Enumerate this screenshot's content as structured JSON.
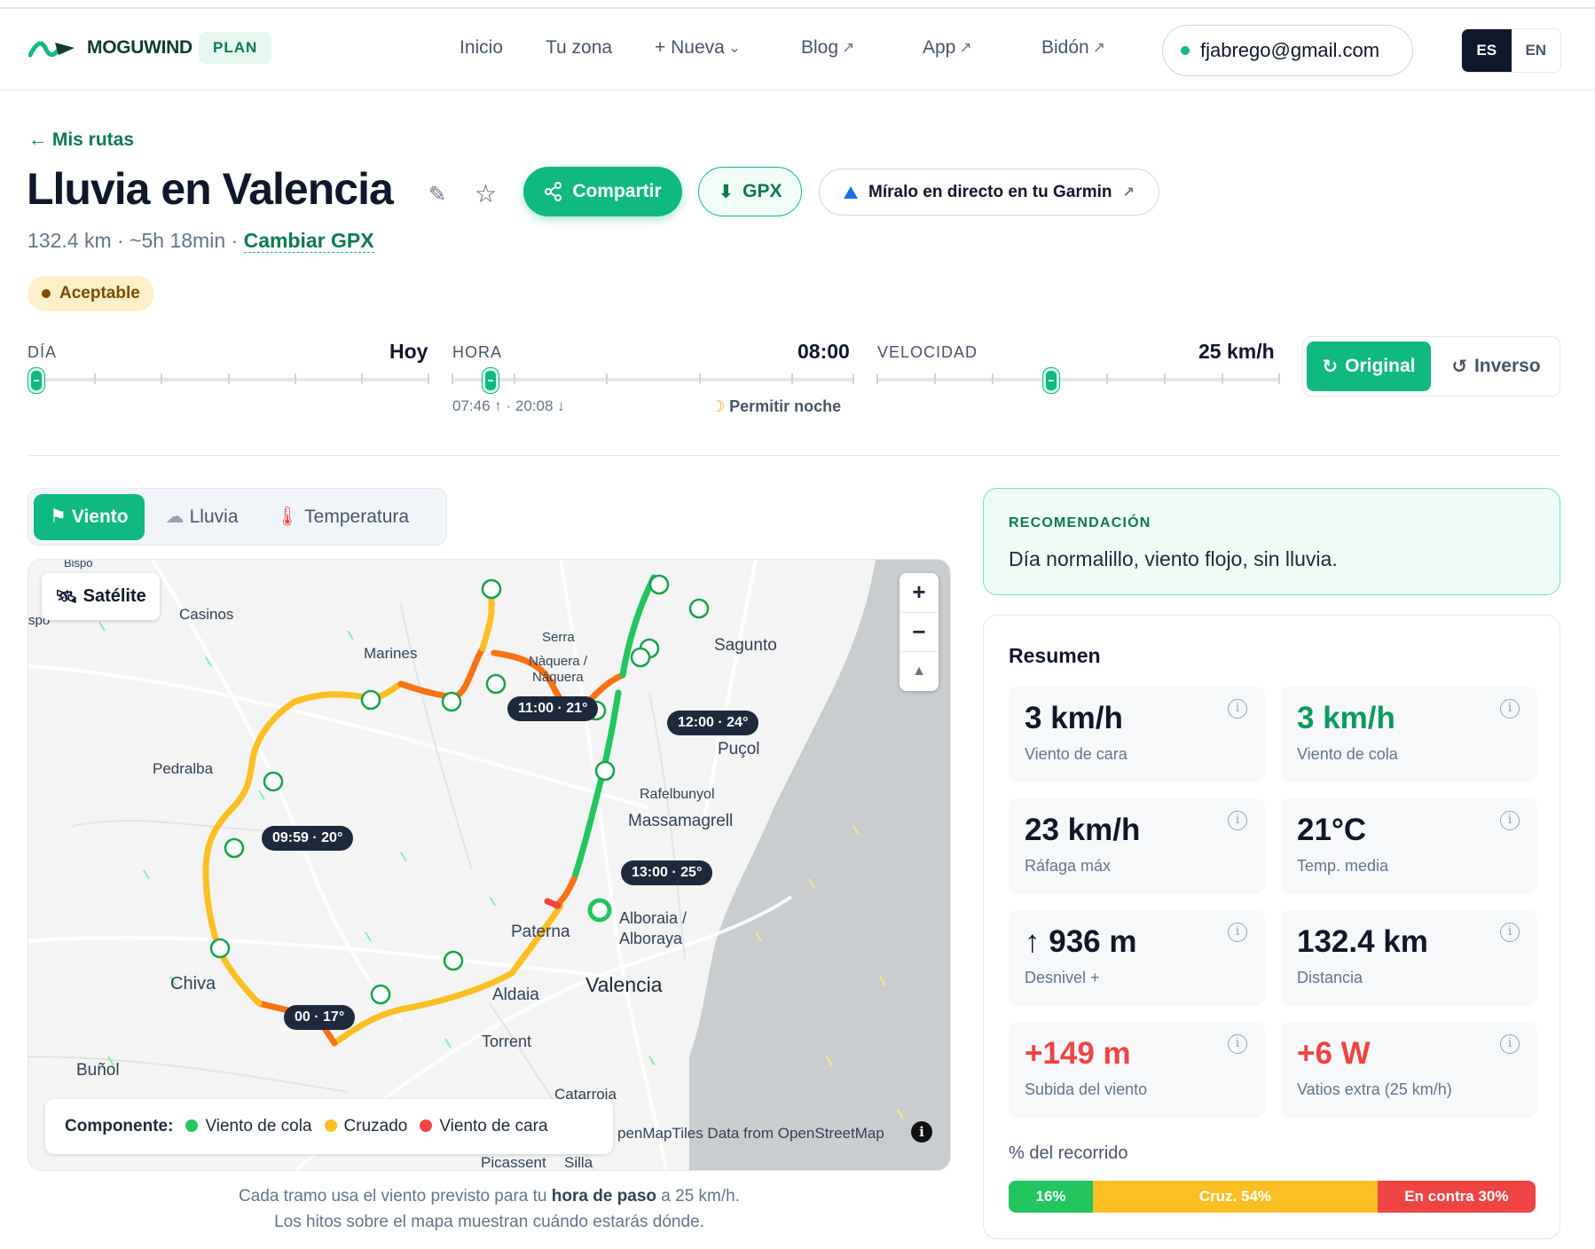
{
  "header": {
    "brand": "MOGUWIND",
    "plan": "PLAN",
    "nav": [
      {
        "label": "Inicio",
        "arrow": ""
      },
      {
        "label": "Tu zona",
        "arrow": ""
      },
      {
        "label": "+ Nueva",
        "arrow": "⌄"
      },
      {
        "label": "Blog",
        "arrow": "↗"
      },
      {
        "label": "App",
        "arrow": "↗"
      },
      {
        "label": "Bidón",
        "arrow": "↗"
      }
    ],
    "email": "fjabrego@gmail.com",
    "lang": {
      "es": "ES",
      "en": "EN"
    }
  },
  "route": {
    "back": "← Mis rutas",
    "title": "Lluvia en Valencia",
    "share": "Compartir",
    "gpx": "GPX",
    "garmin": "Míralo en directo en tu Garmin",
    "distance": "132.4 km",
    "duration": "~5h 18min",
    "change_gpx": "Cambiar GPX",
    "rating": "Aceptable",
    "rating_color": "#7c4a03"
  },
  "sliders": {
    "day": {
      "label": "DÍA",
      "value": "Hoy"
    },
    "hour": {
      "label": "HORA",
      "value": "08:00",
      "sunrise": "07:46 ↑ · 20:08 ↓",
      "night": "Permitir noche"
    },
    "speed": {
      "label": "VELOCIDAD",
      "value": "25 km/h"
    },
    "direction": {
      "original": "Original",
      "inverse": "Inverso"
    }
  },
  "layers": {
    "wind": "Viento",
    "rain": "Lluvia",
    "temp": "Temperatura"
  },
  "map": {
    "satellite": "Satélite",
    "towns": [
      "Casinos",
      "Marines",
      "Serra",
      "Nàquera /",
      "Náquera",
      "Sagunto",
      "Pedralba",
      "Rafelbunyol",
      "Massamagrell",
      "Alboraia /",
      "Alboraya",
      "Paterna",
      "Chiva",
      "Aldaia",
      "Valencia",
      "Torrent",
      "Buñol",
      "Catarroja",
      "Picassent",
      "Silla",
      "spo",
      "Bispo",
      "Puçol"
    ],
    "waypoints": [
      "11:00 · 21°",
      "12:00 · 24°",
      "09:59 · 20°",
      "13:00 · 25°",
      "00 · 17°"
    ],
    "legend": {
      "title": "Componente:",
      "tail": "Viento de cola",
      "cross": "Cruzado",
      "head": "Viento de cara"
    },
    "attribution": "penMapTiles Data from OpenStreetMap",
    "colors": {
      "tail": "#22c55e",
      "cross": "#fbbf24",
      "head": "#ef4444",
      "mixed": "#f97316"
    }
  },
  "caption": {
    "line1_a": "Cada tramo usa el viento previsto para tu ",
    "line1_b": "hora de paso",
    "line1_c": " a 25 km/h.",
    "line2": "Los hitos sobre el mapa muestran cuándo estarás dónde."
  },
  "recommendation": {
    "label": "RECOMENDACIÓN",
    "text": "Día normalillo, viento flojo, sin lluvia."
  },
  "summary": {
    "title": "Resumen",
    "cards": [
      {
        "value": "3 km/h",
        "label": "Viento de cara",
        "tone": ""
      },
      {
        "value": "3 km/h",
        "label": "Viento de cola",
        "tone": "green"
      },
      {
        "value": "23 km/h",
        "label": "Ráfaga máx",
        "tone": ""
      },
      {
        "value": "21°C",
        "label": "Temp. media",
        "tone": ""
      },
      {
        "value": "↑ 936 m",
        "label": "Desnivel +",
        "tone": ""
      },
      {
        "value": "132.4 km",
        "label": "Distancia",
        "tone": ""
      },
      {
        "value": "+149 m",
        "label": "Subida del viento",
        "tone": "red"
      },
      {
        "value": "+6 W",
        "label": "Vatios extra (25 km/h)",
        "tone": "red"
      }
    ],
    "pct_label": "% del recorrido",
    "pct": [
      {
        "label": "16%",
        "value": 16,
        "color": "#22c55e"
      },
      {
        "label": "Cruz. 54%",
        "value": 54,
        "color": "#fbbf24"
      },
      {
        "label": "En contra 30%",
        "value": 30,
        "color": "#ef4444"
      }
    ]
  }
}
